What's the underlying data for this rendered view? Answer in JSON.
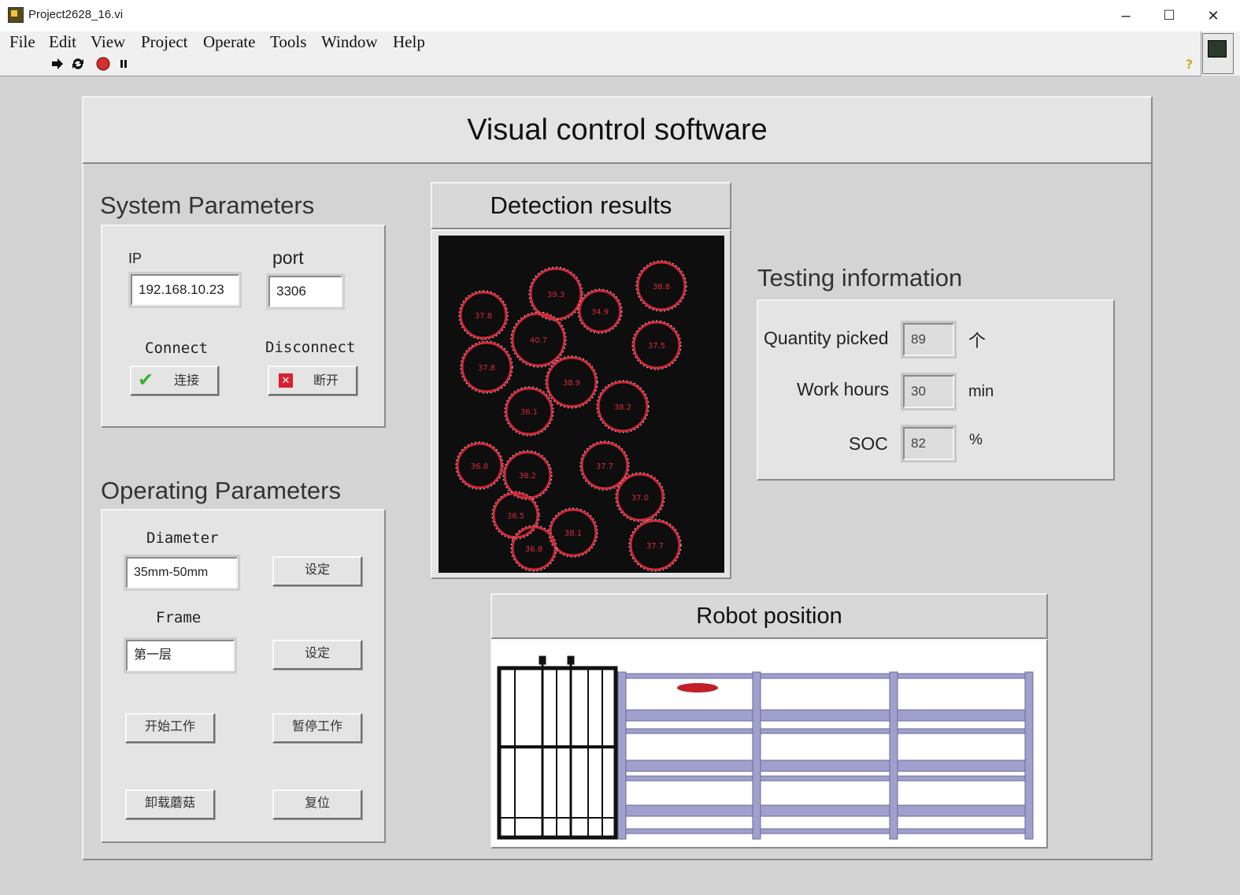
{
  "window": {
    "title": "Project2628_16.vi",
    "minimize": "–",
    "maximize": "☐",
    "close": "✕"
  },
  "menu": [
    "File",
    "Edit",
    "View",
    "Project",
    "Operate",
    "Tools",
    "Window",
    "Help"
  ],
  "toolbar": {
    "icons": [
      "run-arrow-icon",
      "run-continuously-icon",
      "abort-icon",
      "pause-icon",
      "help-icon"
    ]
  },
  "app_title": "Visual control software",
  "system": {
    "title": "System Parameters",
    "ip_label": "IP",
    "ip_value": "192.168.10.23",
    "port_label": "port",
    "port_value": "3306",
    "connect_label": "Connect",
    "connect_button": "连接",
    "disconnect_label": "Disconnect",
    "disconnect_button": "断开"
  },
  "operating": {
    "title": "Operating Parameters",
    "diameter_label": "Diameter",
    "diameter_value": "35mm-50mm",
    "set_button_1": "设定",
    "frame_label": "Frame",
    "frame_value": "第一层",
    "set_button_2": "设定",
    "start_button": "开始工作",
    "pause_button": "暂停工作",
    "unload_button": "卸载蘑菇",
    "reset_button": "复位"
  },
  "detection": {
    "title": "Detection results",
    "circles": [
      "39.3",
      "38.8",
      "37.8",
      "34.9",
      "40.7",
      "37.5",
      "37.8",
      "38.9",
      "36.1",
      "38.2",
      "36.8",
      "38.2",
      "37.7",
      "37.0",
      "36.5",
      "38.1",
      "36.8",
      "37.7"
    ]
  },
  "testing": {
    "title": "Testing information",
    "quantity_label": "Quantity picked",
    "quantity_value": "89",
    "quantity_unit": "个",
    "hours_label": "Work hours",
    "hours_value": "30",
    "hours_unit": "min",
    "soc_label": "SOC",
    "soc_value": "82",
    "soc_unit": "%"
  },
  "robot": {
    "title": "Robot position"
  },
  "colors": {
    "circle": "#d42a3a",
    "rail": "#9a9ac8",
    "robot_marker": "#c02028",
    "panel": "#d4d4d4"
  }
}
